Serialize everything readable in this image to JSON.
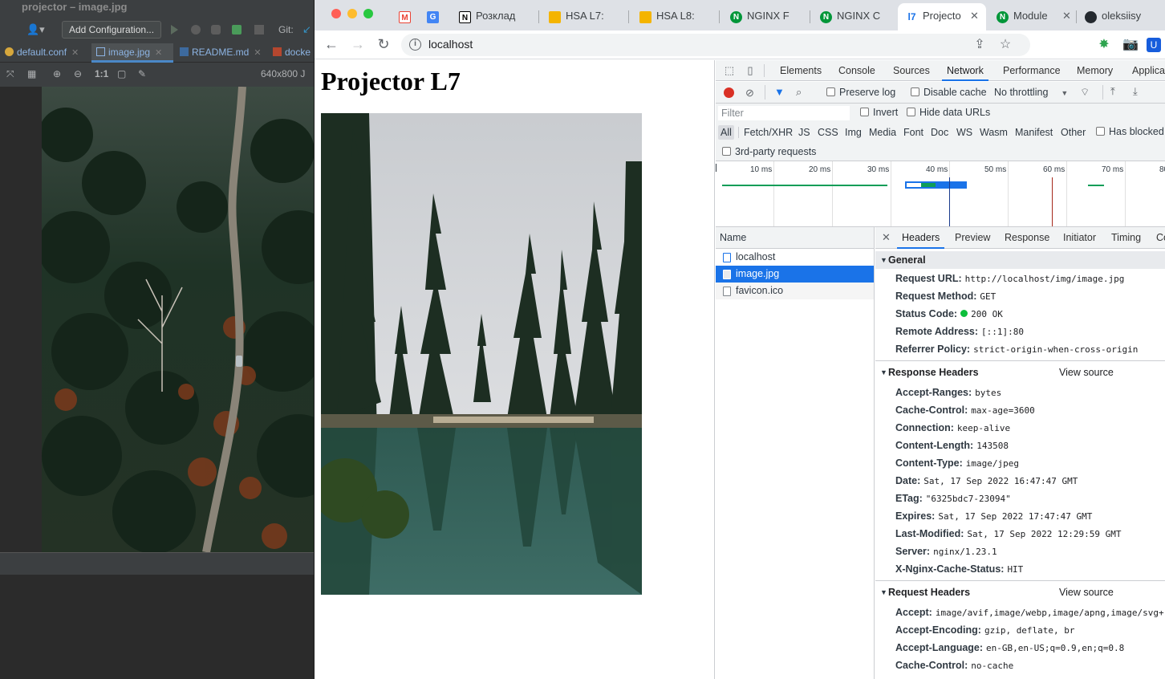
{
  "ide": {
    "title": "projector – image.jpg",
    "run_config_label": "Add Configuration...",
    "git_label": "Git:",
    "tabs": [
      {
        "label": "default.conf"
      },
      {
        "label": "image.jpg"
      },
      {
        "label": "README.md"
      },
      {
        "label": "docke"
      }
    ],
    "image_toolbar": {
      "zoom_actual": "1:1",
      "dimensions": "640x800 J"
    }
  },
  "browser": {
    "tabs": [
      {
        "label": "",
        "favicon": "gmail-icon",
        "color": "#ea4335"
      },
      {
        "label": "",
        "favicon": "google-translate-icon",
        "color": "#4285f4"
      },
      {
        "label": "Розклад",
        "favicon": "notion-icon",
        "color": "#000000"
      },
      {
        "label": "HSA L7:",
        "favicon": "slides-icon",
        "color": "#f4b400"
      },
      {
        "label": "HSA L8:",
        "favicon": "slides-icon",
        "color": "#f4b400"
      },
      {
        "label": "NGINX F",
        "favicon": "nginx-icon",
        "color": "#009639"
      },
      {
        "label": "NGINX C",
        "favicon": "nginx-icon",
        "color": "#009639"
      },
      {
        "label": "Projecto",
        "favicon": "projector-icon",
        "color": "#1a73e8"
      },
      {
        "label": "Module",
        "favicon": "nginx-icon",
        "color": "#009639"
      },
      {
        "label": "oleksiisy",
        "favicon": "github-icon",
        "color": "#24292f"
      }
    ],
    "url": "localhost"
  },
  "page": {
    "heading": "Projector L7"
  },
  "devtools": {
    "tabs": [
      "Elements",
      "Console",
      "Sources",
      "Network",
      "Performance",
      "Memory",
      "Applicat"
    ],
    "active_tab": "Network",
    "toolbar": {
      "preserve_log": "Preserve log",
      "disable_cache": "Disable cache",
      "throttling": "No throttling"
    },
    "filter": {
      "placeholder": "Filter",
      "invert": "Invert",
      "hide_data_urls": "Hide data URLs"
    },
    "types": [
      "All",
      "Fetch/XHR",
      "JS",
      "CSS",
      "Img",
      "Media",
      "Font",
      "Doc",
      "WS",
      "Wasm",
      "Manifest",
      "Other"
    ],
    "has_blocked": "Has blocked",
    "third_party": "3rd-party requests",
    "timeline_labels": [
      "10 ms",
      "20 ms",
      "30 ms",
      "40 ms",
      "50 ms",
      "60 ms",
      "70 ms",
      "80"
    ],
    "name_header": "Name",
    "requests": [
      {
        "name": "localhost"
      },
      {
        "name": "image.jpg"
      },
      {
        "name": "favicon.ico"
      }
    ],
    "detail_tabs": [
      "Headers",
      "Preview",
      "Response",
      "Initiator",
      "Timing",
      "Co"
    ],
    "general": {
      "title": "General",
      "rows": [
        {
          "key": "Request URL:",
          "value": "http://localhost/img/image.jpg"
        },
        {
          "key": "Request Method:",
          "value": "GET"
        },
        {
          "key": "Status Code:",
          "value": "200 OK"
        },
        {
          "key": "Remote Address:",
          "value": "[::1]:80"
        },
        {
          "key": "Referrer Policy:",
          "value": "strict-origin-when-cross-origin"
        }
      ]
    },
    "response_headers": {
      "title": "Response Headers",
      "view_source": "View source",
      "rows": [
        {
          "key": "Accept-Ranges:",
          "value": "bytes"
        },
        {
          "key": "Cache-Control:",
          "value": "max-age=3600"
        },
        {
          "key": "Connection:",
          "value": "keep-alive"
        },
        {
          "key": "Content-Length:",
          "value": "143508"
        },
        {
          "key": "Content-Type:",
          "value": "image/jpeg"
        },
        {
          "key": "Date:",
          "value": "Sat, 17 Sep 2022 16:47:47 GMT"
        },
        {
          "key": "ETag:",
          "value": "\"6325bdc7-23094\""
        },
        {
          "key": "Expires:",
          "value": "Sat, 17 Sep 2022 17:47:47 GMT"
        },
        {
          "key": "Last-Modified:",
          "value": "Sat, 17 Sep 2022 12:29:59 GMT"
        },
        {
          "key": "Server:",
          "value": "nginx/1.23.1"
        },
        {
          "key": "X-Nginx-Cache-Status:",
          "value": "HIT"
        }
      ]
    },
    "request_headers": {
      "title": "Request Headers",
      "view_source": "View source",
      "rows": [
        {
          "key": "Accept:",
          "value": "image/avif,image/webp,image/apng,image/svg+"
        },
        {
          "key": "Accept-Encoding:",
          "value": "gzip, deflate, br"
        },
        {
          "key": "Accept-Language:",
          "value": "en-GB,en-US;q=0.9,en;q=0.8"
        },
        {
          "key": "Cache-Control:",
          "value": "no-cache"
        }
      ]
    }
  }
}
